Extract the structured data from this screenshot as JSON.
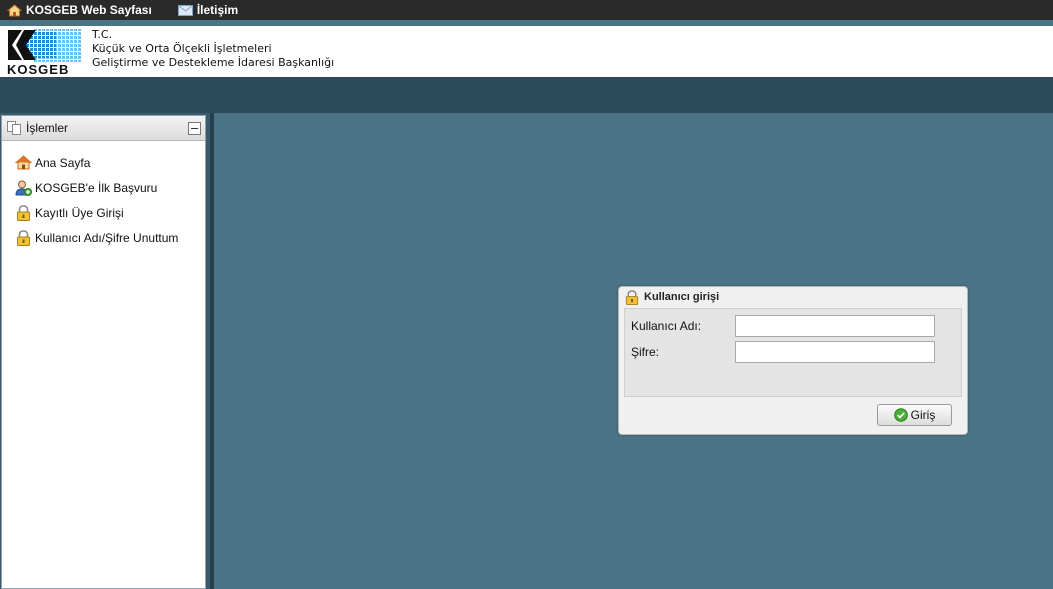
{
  "topbar": {
    "home_link": "KOSGEB Web Sayfası",
    "contact_link": "İletişim"
  },
  "header": {
    "logo_text": "KOSGEB",
    "org_line1": "T.C.",
    "org_line2": "Küçük ve Orta Ölçekli İşletmeleri",
    "org_line3": "Geliştirme ve Destekleme İdaresi Başkanlığı"
  },
  "sidebar": {
    "title": "İşlemler",
    "items": [
      {
        "label": "Ana Sayfa",
        "icon": "home-icon"
      },
      {
        "label": "KOSGEB'e İlk Başvuru",
        "icon": "user-add-icon"
      },
      {
        "label": "Kayıtlı Üye Girişi",
        "icon": "lock-icon"
      },
      {
        "label": "Kullanıcı Adı/Şifre Unuttum",
        "icon": "lock-icon"
      }
    ]
  },
  "login": {
    "title": "Kullanıcı girişi",
    "username_label": "Kullanıcı Adı:",
    "username_value": "",
    "password_label": "Şifre:",
    "password_value": "",
    "submit_label": "Giriş"
  },
  "colors": {
    "topbar": "#2a2a2a",
    "navband": "#2d4a5d",
    "content_bg": "#4a7385",
    "logo_blue": "#1d8fd6"
  }
}
